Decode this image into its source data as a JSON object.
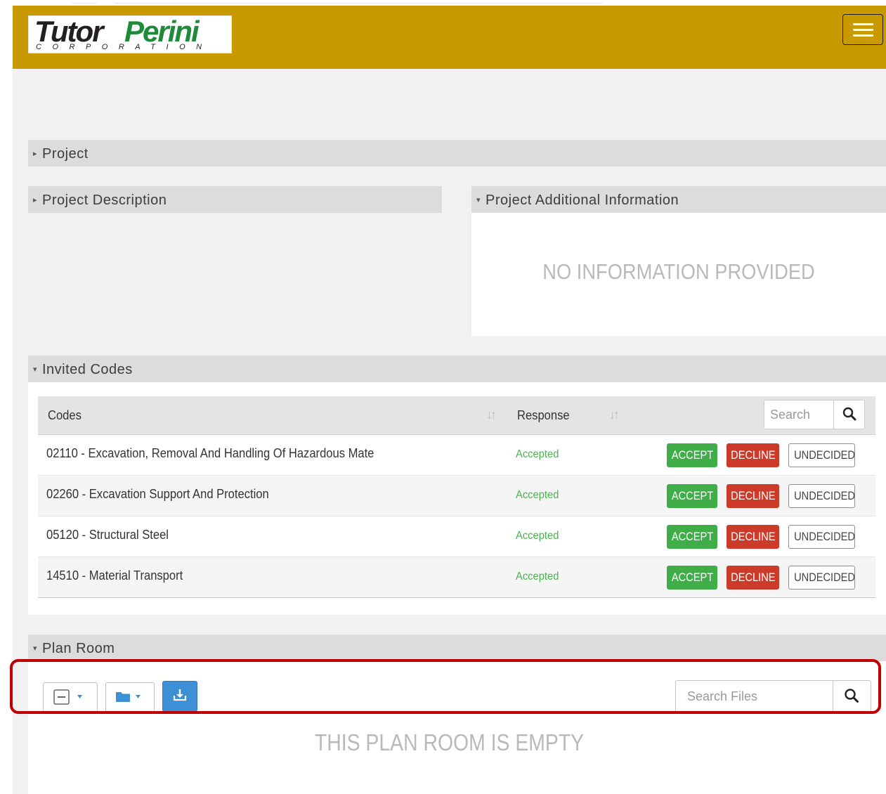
{
  "logo": {
    "word1": "Tutor",
    "word2": "Perini",
    "subtitle": "CORPORATION"
  },
  "sections": {
    "project": "Project",
    "project_description": "Project Description",
    "project_additional": "Project Additional Information",
    "invited_codes": "Invited Codes",
    "plan_room": "Plan Room"
  },
  "additional_info": {
    "message": "NO INFORMATION PROVIDED"
  },
  "codes_table": {
    "columns": {
      "codes": "Codes",
      "response": "Response"
    },
    "search_placeholder": "Search",
    "rows": [
      {
        "code": "02110 - Excavation, Removal And Handling Of Hazardous Mate",
        "response": "Accepted"
      },
      {
        "code": "02260 - Excavation Support And Protection",
        "response": "Accepted"
      },
      {
        "code": "05120 - Structural Steel",
        "response": "Accepted"
      },
      {
        "code": "14510 - Material Transport",
        "response": "Accepted"
      }
    ],
    "actions": {
      "accept": "ACCEPT",
      "decline": "DECLINE",
      "undecided": "UNDECIDED"
    }
  },
  "plan_room": {
    "search_placeholder": "Search Files",
    "empty_message": "THIS PLAN ROOM IS EMPTY"
  },
  "colors": {
    "header": "#c99a00",
    "accept": "#3fae49",
    "decline": "#cc3b2a",
    "accepted_text": "#4caf50",
    "download": "#3d8fd6",
    "highlight": "#c00000"
  }
}
